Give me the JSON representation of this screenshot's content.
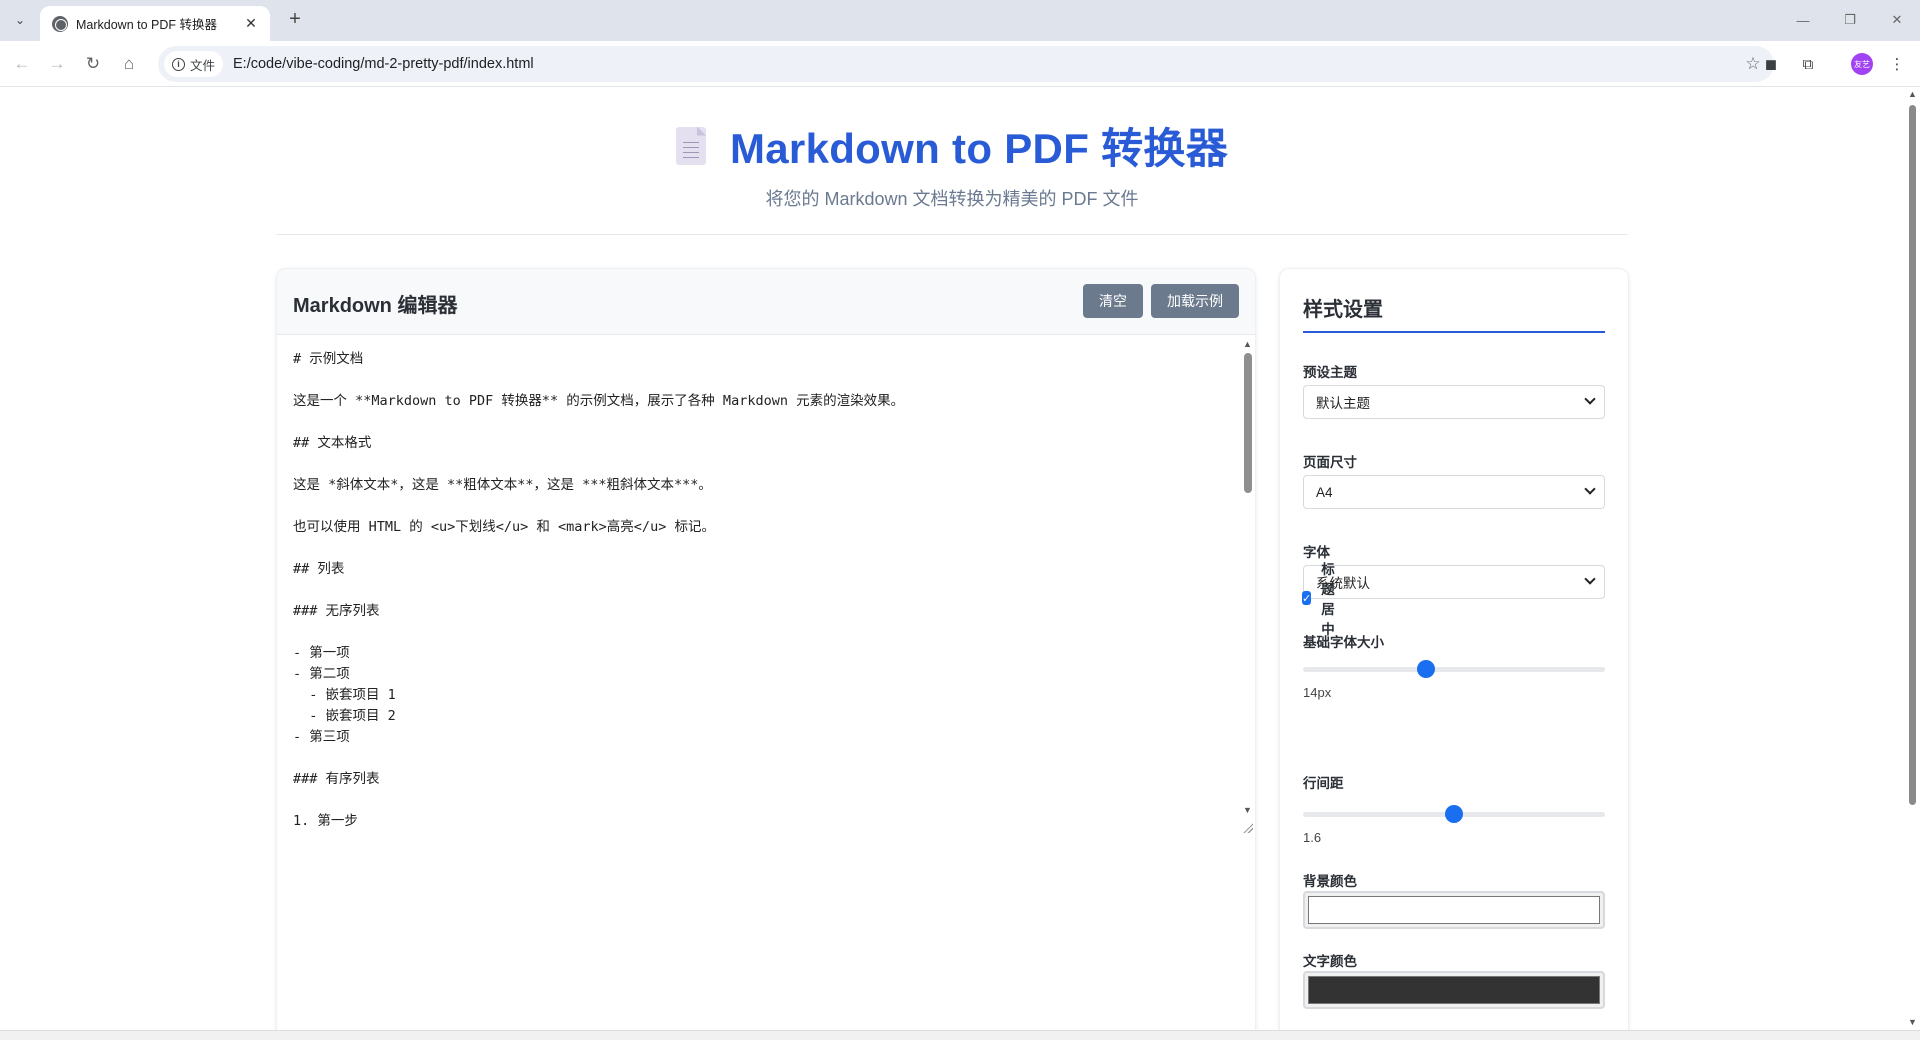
{
  "browser": {
    "tab_title": "Markdown to PDF 转换器",
    "new_tab": "+",
    "site_chip": "文件",
    "url": "E:/code/vibe-coding/md-2-pretty-pdf/index.html",
    "profile_initials": "友艺",
    "profile_color": "#a142f4"
  },
  "header": {
    "title": "Markdown to PDF 转换器",
    "subtitle": "将您的 Markdown 文档转换为精美的 PDF 文件",
    "title_color": "#2a5bd7"
  },
  "editor": {
    "title": "Markdown 编辑器",
    "clear_label": "清空",
    "sample_label": "加载示例",
    "content": "# 示例文档\n\n这是一个 **Markdown to PDF 转换器** 的示例文档，展示了各种 Markdown 元素的渲染效果。\n\n## 文本格式\n\n这是 *斜体文本*，这是 **粗体文本**，这是 ***粗斜体文本***。\n\n也可以使用 HTML 的 <u>下划线</u> 和 <mark>高亮</u> 标记。\n\n## 列表\n\n### 无序列表\n\n- 第一项\n- 第二项\n  - 嵌套项目 1\n  - 嵌套项目 2\n- 第三项\n\n### 有序列表\n\n1. 第一步"
  },
  "settings": {
    "title": "样式设置",
    "theme_label": "预设主题",
    "theme_value": "默认主题",
    "page_size_label": "页面尺寸",
    "page_size_value": "A4",
    "font_label": "字体",
    "font_value": "系统默认",
    "font_size_label": "基础字体大小",
    "font_size_value": "14px",
    "font_size_fraction": 0.4,
    "center_title_label": "标题居中",
    "center_title_checked": true,
    "line_height_label": "行间距",
    "line_height_value": "1.6",
    "line_height_fraction": 0.5,
    "bg_color_label": "背景颜色",
    "bg_color": "#ffffff",
    "text_color_label": "文字颜色",
    "text_color": "#333333"
  }
}
